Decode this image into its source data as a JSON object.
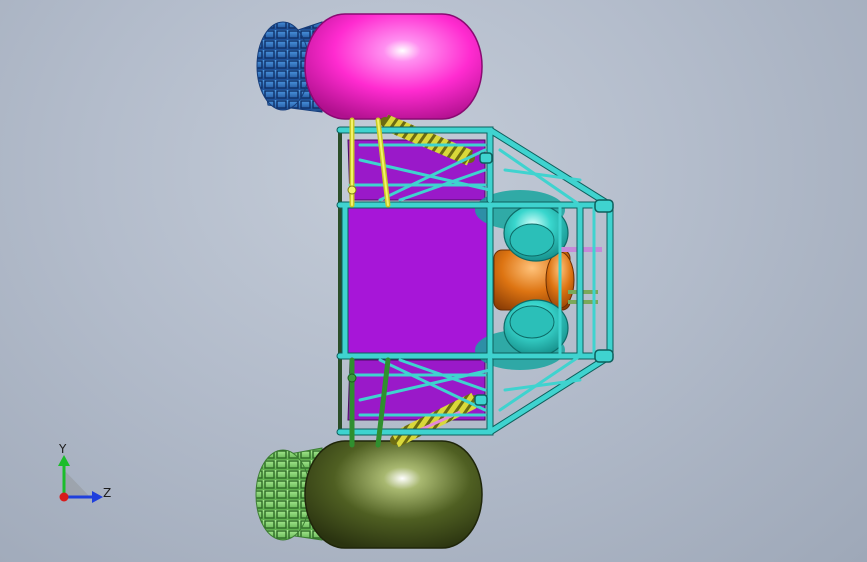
{
  "viewport": {
    "background": "#b3bccb",
    "axes": {
      "y_label": "Y",
      "z_label": "Z"
    }
  },
  "colors": {
    "frame": "#3fd3cf",
    "panel": "#a716d8",
    "wheel_top": "#ff2bd0",
    "wheel_bottom": "#4a5a22",
    "tire_top": "#2f6fc0",
    "tire_bottom": "#7fcf6a",
    "spring": "#e6e44a",
    "engine": "#d66b10",
    "intake": "#2fd0c8"
  },
  "model": {
    "name": "buggy-chassis-top-view"
  }
}
